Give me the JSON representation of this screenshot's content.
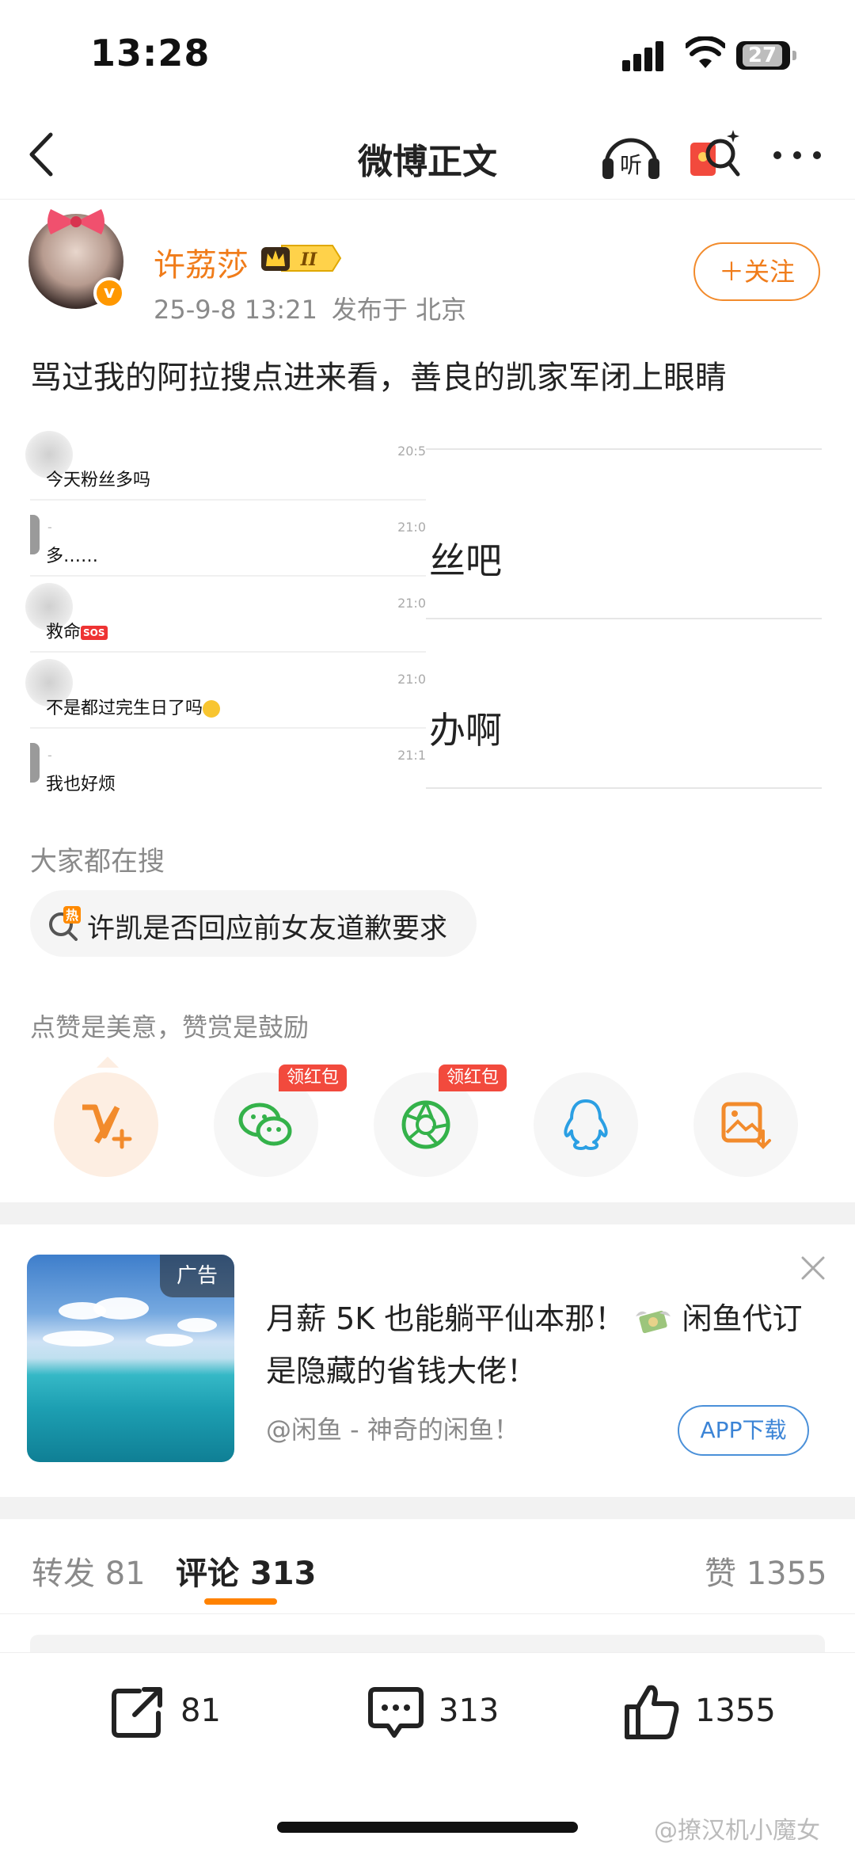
{
  "status_bar": {
    "time": "13:28",
    "battery": "27"
  },
  "nav": {
    "title": "微博正文",
    "listen_label": "听"
  },
  "author": {
    "name": "许荔莎",
    "vip_level": "II",
    "verified_badge": "v",
    "date": "25-9-8 13:21",
    "location": "发布于 北京",
    "follow_label": "＋关注"
  },
  "post": {
    "text": "骂过我的阿拉搜点进来看，善良的凯家军闭上眼睛",
    "chat": [
      {
        "text": "今天粉丝多吗",
        "time": "20:5"
      },
      {
        "text": "多……",
        "time": "21:0"
      },
      {
        "text": "救命",
        "emoji": "SOS",
        "time": "21:0"
      },
      {
        "text": "不是都过完生日了吗",
        "time": "21:0"
      },
      {
        "text": "我也好烦",
        "time": "21:1"
      }
    ],
    "behind_text_1": "丝吧",
    "behind_text_2": "办啊"
  },
  "search": {
    "heading": "大家都在搜",
    "hot_tag": "热",
    "hot_item": "许凯是否回应前女友道歉要求"
  },
  "reward": {
    "heading": "点赞是美意，赞赏是鼓励",
    "red_packet_label": "领红包",
    "buttons": [
      "v-plus-reward",
      "wechat",
      "moments",
      "qq",
      "save-image"
    ]
  },
  "ad": {
    "tag": "广告",
    "title_part1": "月薪 5K 也能躺平仙本那！",
    "title_part2": "闲鱼代订是隐藏的省钱大佬！",
    "source": "@闲鱼 - 神奇的闲鱼！",
    "button": "APP下载"
  },
  "tabs": {
    "repost_label": "转发",
    "repost_count": "81",
    "comment_label": "评论",
    "comment_count": "313",
    "like_label": "赞",
    "like_count": "1355"
  },
  "bottom_bar": {
    "repost": "81",
    "comment": "313",
    "like": "1355"
  },
  "watermark": "@撩汉机小魔女",
  "colors": {
    "accent_orange": "#ff8200",
    "name_orange": "#f07c1a",
    "red_tag": "#f24a3d",
    "link_blue": "#3b84d6"
  }
}
